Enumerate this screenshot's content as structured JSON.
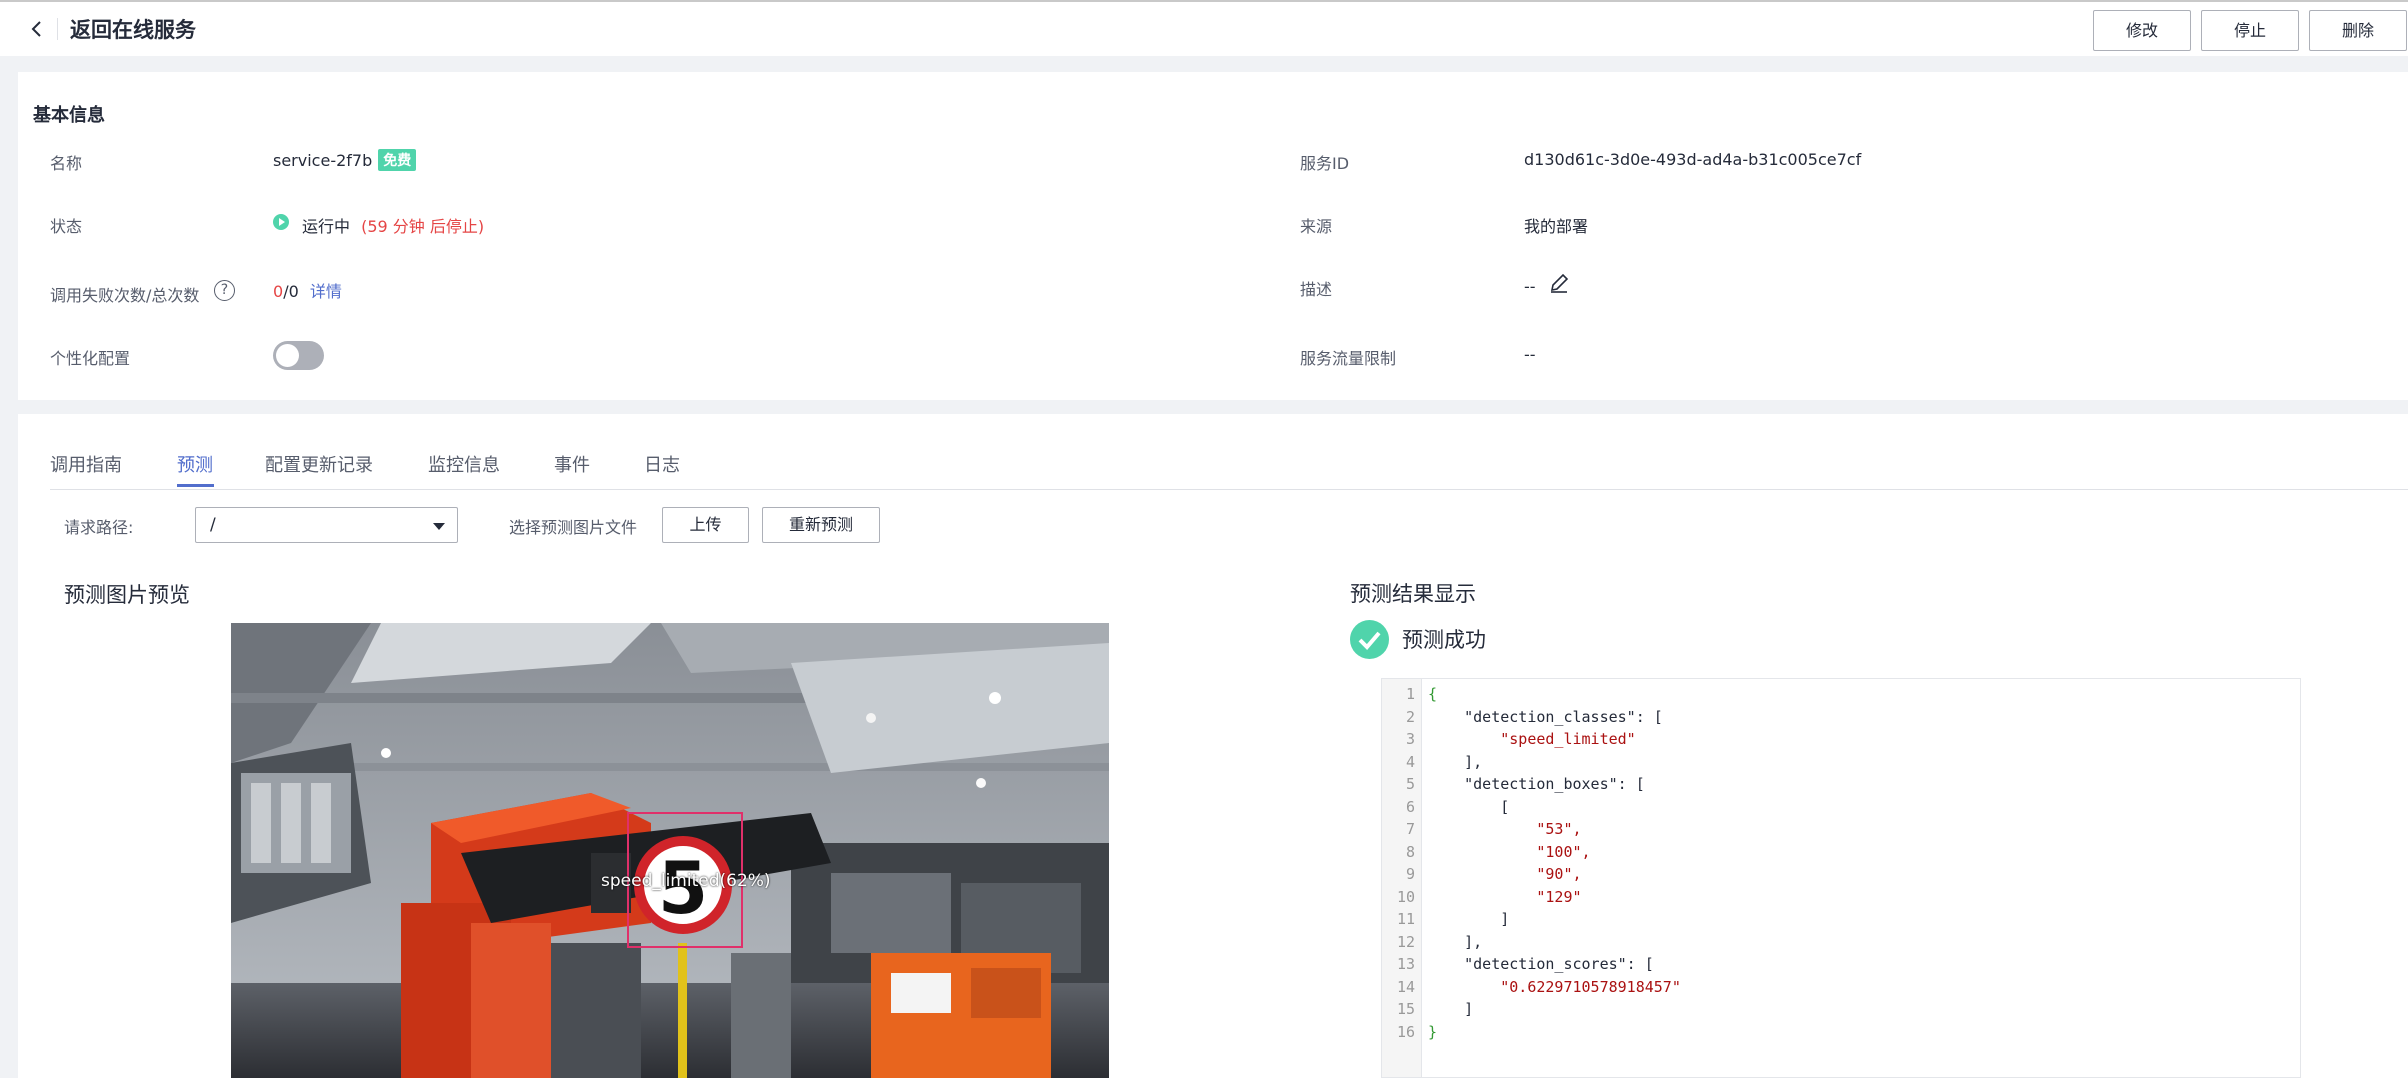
{
  "header": {
    "title": "返回在线服务",
    "buttons": {
      "modify": "修改",
      "stop": "停止",
      "delete": "删除"
    }
  },
  "basic_info": {
    "title": "基本信息",
    "name_label": "名称",
    "name_value": "service-2f7b",
    "free_tag": "免费",
    "status_label": "状态",
    "status_value": "运行中",
    "status_countdown": "(59 分钟 后停止)",
    "calls_label": "调用失败次数/总次数",
    "calls_failed": "0",
    "calls_total": "/0",
    "calls_detail_link": "详情",
    "personal_label": "个性化配置",
    "service_id_label": "服务ID",
    "service_id_value": "d130d61c-3d0e-493d-ad4a-b31c005ce7cf",
    "source_label": "来源",
    "source_value": "我的部署",
    "desc_label": "描述",
    "desc_value": "--",
    "limit_label": "服务流量限制",
    "limit_value": "--"
  },
  "tabs": [
    "调用指南",
    "预测",
    "配置更新记录",
    "监控信息",
    "事件",
    "日志"
  ],
  "predict": {
    "path_label": "请求路径:",
    "path_value": "/",
    "file_label": "选择预测图片文件",
    "upload_button": "上传",
    "repredict_button": "重新预测",
    "preview_title": "预测图片预览",
    "result_title": "预测结果显示",
    "success_text": "预测成功",
    "bbox_label": "speed_limited(62%)"
  },
  "result_code": {
    "line_numbers": [
      "1",
      "2",
      "3",
      "4",
      "5",
      "6",
      "7",
      "8",
      "9",
      "10",
      "11",
      "12",
      "13",
      "14",
      "15",
      "16"
    ],
    "lines": [
      "{",
      "    \"detection_classes\": [",
      "        \"speed_limited\"",
      "    ],",
      "    \"detection_boxes\": [",
      "        [",
      "            \"53\",",
      "            \"100\",",
      "            \"90\",",
      "            \"129\"",
      "        ]",
      "    ],",
      "    \"detection_scores\": [",
      "        \"0.6229710578918457\"",
      "    ]",
      "}"
    ]
  },
  "colors": {
    "accent": "#526ecc",
    "success": "#50d4ab",
    "danger": "#e54545"
  },
  "icons": [
    "back-icon",
    "help-icon",
    "edit-icon",
    "chevron-down-icon",
    "success-check-icon",
    "status-running-icon"
  ]
}
